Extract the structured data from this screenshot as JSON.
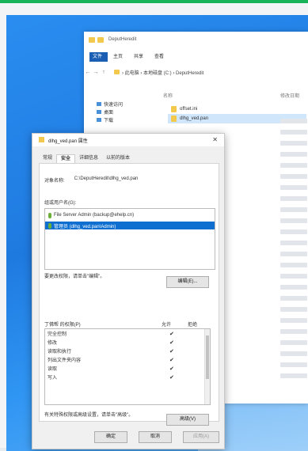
{
  "screen": {
    "top_bar_color": "#19b35a"
  },
  "explorer": {
    "title": "DeputHeredit",
    "ribbon_tabs": [
      "文件",
      "主页",
      "共享",
      "查看"
    ],
    "address": "› 此电脑 › 本地磁盘 (C:) › DeputHeredit",
    "column_name": "名称",
    "column_date": "修改日期",
    "nav_items": [
      {
        "label": "快速访问",
        "icon": "star-icon"
      },
      {
        "label": "桌面",
        "icon": "desktop-icon"
      },
      {
        "label": "下载",
        "icon": "download-icon"
      }
    ],
    "files": [
      {
        "name": "offset.ini",
        "selected": false
      },
      {
        "name": "dlhg_ved.pan",
        "selected": true
      }
    ]
  },
  "dialog": {
    "title": "dlhg_ved.pan 属性",
    "close_label": "✕",
    "tabs": [
      "常规",
      "安全",
      "详细信息",
      "以前的版本"
    ],
    "active_tab": "安全",
    "object_label": "对象名称:",
    "object_value": "C:\\DeputHeredit\\dlhg_ved.pan",
    "groups_label": "组或用户名(G):",
    "users": [
      {
        "name": "File Server Admin (backup@ehelp.cn)",
        "selected": false
      },
      {
        "name": "管理员 (dlhg_ved.pan\\Admin)",
        "selected": true
      }
    ],
    "edit_hint": "要更改权限，请单击\"编辑\"。",
    "edit_button": "编辑(E)...",
    "perm_header": {
      "name": "丁佛帮 的权限(P)",
      "allow": "允许",
      "deny": "拒绝"
    },
    "permissions": [
      {
        "name": "完全控制",
        "allow": "✔",
        "deny": ""
      },
      {
        "name": "修改",
        "allow": "✔",
        "deny": ""
      },
      {
        "name": "读取和执行",
        "allow": "✔",
        "deny": ""
      },
      {
        "name": "列出文件夹内容",
        "allow": "✔",
        "deny": ""
      },
      {
        "name": "读取",
        "allow": "✔",
        "deny": ""
      },
      {
        "name": "写入",
        "allow": "✔",
        "deny": ""
      }
    ],
    "special_hint": "有关特殊权限或高级设置，请单击\"高级\"。",
    "advanced_button": "高级(V)",
    "ok_button": "确定",
    "cancel_button": "取消",
    "apply_button": "应用(A)"
  }
}
